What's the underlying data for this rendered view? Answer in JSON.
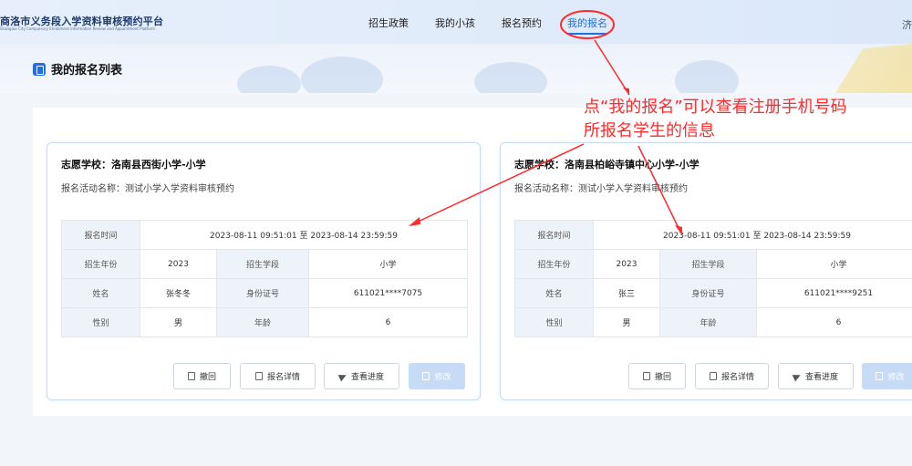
{
  "header": {
    "logo_title": "商洛市义务段入学资料审核预约平台",
    "logo_subtitle": "Shangluo City Compulsory Enrollment Information Review and Appointment Platform",
    "nav": [
      "招生政策",
      "我的小孩",
      "报名预约",
      "我的报名"
    ],
    "active_nav": "我的报名",
    "user_corner": "济"
  },
  "page": {
    "title": "我的报名列表"
  },
  "annotation": {
    "line1": "点“我的报名”可以查看注册手机号码",
    "line2": "所报名学生的信息",
    "color": "#ff2a2a"
  },
  "labels": {
    "school_prefix": "志愿学校：",
    "activity_prefix": "报名活动名称：",
    "time": "报名时间",
    "year": "招生年份",
    "stage": "招生学段",
    "name": "姓名",
    "id": "身份证号",
    "gender": "性别",
    "age": "年龄"
  },
  "buttons": {
    "withdraw": "撤回",
    "detail": "报名详情",
    "progress": "查看进度",
    "edit": "修改"
  },
  "cards": [
    {
      "school": "洛南县西街小学-小学",
      "activity": "测试小学入学资料审核预约",
      "time": "2023-08-11 09:51:01 至 2023-08-14 23:59:59",
      "year": "2023",
      "stage": "小学",
      "name": "张冬冬",
      "id": "611021****7075",
      "gender": "男",
      "age": "6"
    },
    {
      "school": "洛南县柏峪寺镇中心小学-小学",
      "activity": "测试小学入学资料审核预约",
      "time": "2023-08-11 09:51:01 至 2023-08-14 23:59:59",
      "year": "2023",
      "stage": "小学",
      "name": "张三",
      "id": "611021****9251",
      "gender": "男",
      "age": "6"
    }
  ],
  "colors": {
    "accent": "#1e6fe8",
    "card_border": "#c9dcf4",
    "table_label_bg": "#eef3fa"
  }
}
